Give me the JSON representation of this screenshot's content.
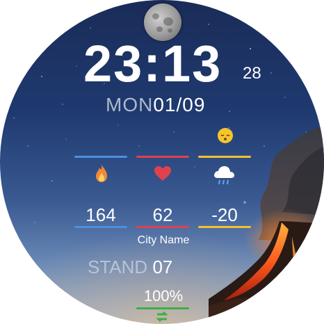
{
  "time": {
    "hours_minutes": "23:13",
    "seconds": "28"
  },
  "date": {
    "day_of_week": "MON",
    "date": "01/09"
  },
  "complications": {
    "calories": {
      "value": "164",
      "icon": "flame-icon",
      "color": "#4a90e2"
    },
    "heart_rate": {
      "value": "62",
      "icon": "heart-icon",
      "color": "#e0414f"
    },
    "weather": {
      "value": "-20",
      "unit": "°",
      "icon": "cloud-rain-icon",
      "color": "#f2c230"
    }
  },
  "city": "City Name",
  "stand": {
    "label": "STAND",
    "value": "07"
  },
  "battery": {
    "value": "100%",
    "color": "#3cb043"
  },
  "icons": {
    "moon": "moon-phase-icon",
    "sleep": "sleeping-face-icon",
    "charging": "charging-icon"
  }
}
